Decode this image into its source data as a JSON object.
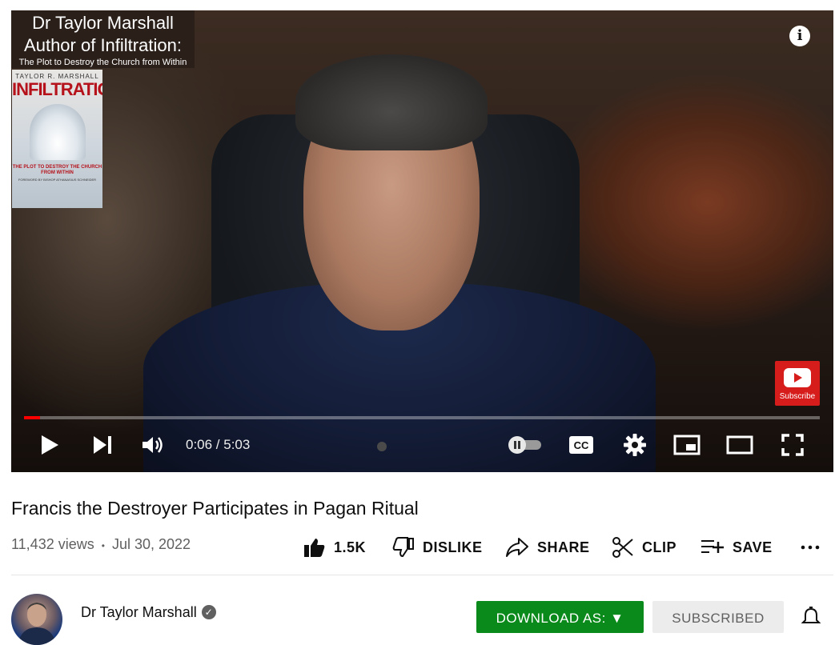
{
  "player": {
    "overlay": {
      "line1": "Dr Taylor Marshall",
      "line2": "Author of Infiltration:",
      "line3": "The Plot to Destroy the Church from Within"
    },
    "book": {
      "author": "TAYLOR R. MARSHALL",
      "title": "INFILTRATION",
      "subtitle": "THE PLOT TO DESTROY THE CHURCH FROM WITHIN",
      "foreword": "FOREWORD BY BISHOP ATHANASIUS SCHNEIDER"
    },
    "info_glyph": "i",
    "subscribe_watermark": "Subscribe",
    "time_display": "0:06 / 5:03",
    "progress_fraction": 0.02,
    "cc_label": "CC"
  },
  "video": {
    "title": "Francis the Destroyer Participates in Pagan Ritual",
    "views": "11,432 views",
    "separator": "•",
    "date": "Jul 30, 2022"
  },
  "actions": {
    "like_count": "1.5K",
    "dislike_label": "DISLIKE",
    "share_label": "SHARE",
    "clip_label": "CLIP",
    "save_label": "SAVE"
  },
  "channel": {
    "name": "Dr Taylor Marshall",
    "verified_glyph": "✓",
    "download_label": "DOWNLOAD AS: ▼",
    "subscribed_label": "SUBSCRIBED"
  },
  "colors": {
    "progress": "#ff0000",
    "download_button": "#0a8a1a",
    "subscribe_watermark": "#d71c1c"
  },
  "icons": {
    "play": "play-icon",
    "next": "next-icon",
    "volume": "volume-icon",
    "autoplay": "autoplay-toggle-icon",
    "captions": "cc-icon",
    "settings": "gear-icon",
    "miniplayer": "miniplayer-icon",
    "theater": "theater-icon",
    "fullscreen": "fullscreen-icon",
    "like": "thumbs-up-icon",
    "dislike": "thumbs-down-icon",
    "share": "share-arrow-icon",
    "clip": "scissors-icon",
    "save": "playlist-add-icon",
    "more": "more-horizontal-icon",
    "bell": "bell-icon"
  }
}
